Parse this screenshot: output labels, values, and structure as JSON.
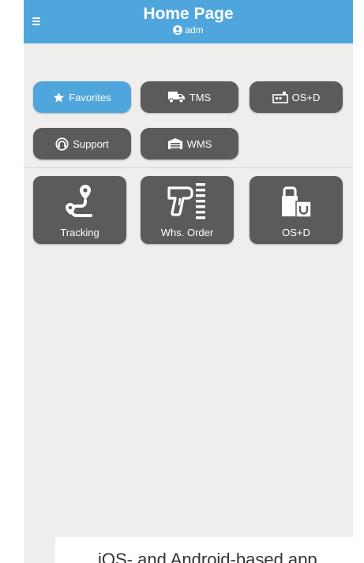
{
  "header": {
    "title": "Home Page",
    "user": "adm",
    "color": "#4fa6dc"
  },
  "tabs": [
    {
      "id": "favorites",
      "label": "Favorites",
      "icon": "star-icon",
      "active": true
    },
    {
      "id": "tms",
      "label": "TMS",
      "icon": "truck-icon",
      "active": false
    },
    {
      "id": "osd",
      "label": "OS+D",
      "icon": "pallet-icon",
      "active": false
    },
    {
      "id": "support",
      "label": "Support",
      "icon": "headset-icon",
      "active": false
    },
    {
      "id": "wms",
      "label": "WMS",
      "icon": "warehouse-icon",
      "active": false
    }
  ],
  "tiles": [
    {
      "id": "tracking",
      "label": "Tracking",
      "icon": "route-pin-icon"
    },
    {
      "id": "whs-order",
      "label": "Whs. Order",
      "icon": "barcode-scanner-icon"
    },
    {
      "id": "osd",
      "label": "OS+D",
      "icon": "damaged-package-icon"
    }
  ],
  "caption": "iOS- and Android-based app",
  "colors": {
    "accent": "#4fa6dc",
    "button": "#5b5b5b",
    "background": "#efeeec"
  }
}
